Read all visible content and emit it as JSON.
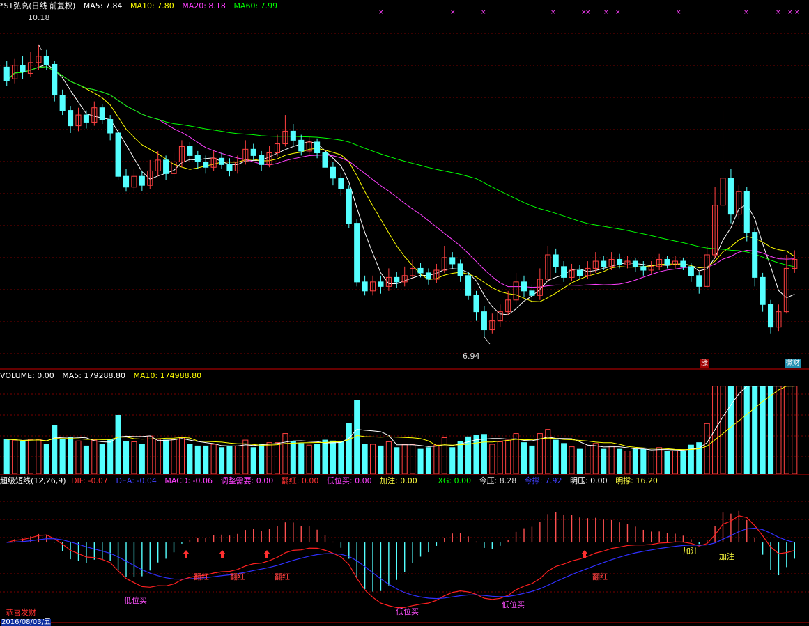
{
  "colors": {
    "bg": "#000000",
    "grid": "#7a0000",
    "divider": "#cc0000",
    "up": "#ff4040",
    "down": "#54ffff",
    "ma5": "#ffffff",
    "ma10": "#ffff00",
    "ma20": "#ff40ff",
    "ma60": "#00ff00",
    "dif": "#ff2020",
    "dea": "#3030ff",
    "macd_pos": "#ff5050",
    "macd_neg": "#54ffff",
    "signal": "#ff3030",
    "low_buy": "#ff50ff",
    "add": "#ffff40"
  },
  "price_panel": {
    "title": "*ST弘高(日线 前复权)",
    "ma5_label": "MA5: 7.84",
    "ma10_label": "MA10: 7.80",
    "ma20_label": "MA20: 8.18",
    "ma60_label": "MA60: 7.99",
    "high_label": "10.18",
    "low_label": "6.94",
    "badge_rise": "涨",
    "badge_fund": "微财"
  },
  "volume_panel": {
    "vol_label": "VOLUME: 0.00",
    "ma5_label": "MA5: 179288.80",
    "ma10_label": "MA10: 174988.80"
  },
  "indicator_panel": {
    "name": "超级短线(12,26,9)",
    "dif_label": "DIF: -0.07",
    "dea_label": "DEA: -0.04",
    "macd_label": "MACD: -0.06",
    "adjust_label": "调整需要: 0.00",
    "turn_red_label": "翻红: 0.00",
    "low_buy_label": "低位买: 0.00",
    "add_label": "加注: 0.00",
    "xg_label": "XG: 0.00",
    "today_press_label": "今压: 8.28",
    "today_support_label": "今撑: 7.92",
    "next_press_label": "明压: 0.00",
    "next_support_label": "明撑: 16.20",
    "signal_turn_red": "翻红",
    "signal_low_buy": "低位买",
    "signal_add": "加注",
    "footer": "恭喜发财",
    "date_partial": "2016/08/03/五"
  },
  "chart_data": {
    "type": "candlestick",
    "ylim": [
      6.6,
      10.55
    ],
    "high": 10.18,
    "low": 6.94,
    "ma_current": {
      "MA5": 7.84,
      "MA10": 7.8,
      "MA20": 8.18,
      "MA60": 7.99
    },
    "candles": [
      [
        9.93,
        9.78,
        10.0,
        9.72
      ],
      [
        9.8,
        9.95,
        10.02,
        9.75
      ],
      [
        9.95,
        9.88,
        10.05,
        9.8
      ],
      [
        9.86,
        9.98,
        10.1,
        9.82
      ],
      [
        9.98,
        10.05,
        10.18,
        9.9
      ],
      [
        10.05,
        9.96,
        10.12,
        9.9
      ],
      [
        9.96,
        9.62,
        10.0,
        9.55
      ],
      [
        9.62,
        9.45,
        9.68,
        9.4
      ],
      [
        9.45,
        9.28,
        9.5,
        9.2
      ],
      [
        9.28,
        9.4,
        9.48,
        9.22
      ],
      [
        9.4,
        9.32,
        9.45,
        9.25
      ],
      [
        9.32,
        9.48,
        9.55,
        9.28
      ],
      [
        9.48,
        9.35,
        9.52,
        9.3
      ],
      [
        9.35,
        9.2,
        9.4,
        9.12
      ],
      [
        9.2,
        8.72,
        9.25,
        8.68
      ],
      [
        8.72,
        8.6,
        8.8,
        8.55
      ],
      [
        8.6,
        8.72,
        8.8,
        8.55
      ],
      [
        8.72,
        8.62,
        8.78,
        8.56
      ],
      [
        8.62,
        8.78,
        8.9,
        8.58
      ],
      [
        8.78,
        8.9,
        9.0,
        8.72
      ],
      [
        8.9,
        8.75,
        8.95,
        8.68
      ],
      [
        8.75,
        8.88,
        8.98,
        8.7
      ],
      [
        8.88,
        9.05,
        9.12,
        8.82
      ],
      [
        9.05,
        8.95,
        9.1,
        8.88
      ],
      [
        8.95,
        8.88,
        9.0,
        8.8
      ],
      [
        8.88,
        8.82,
        8.95,
        8.75
      ],
      [
        8.82,
        8.92,
        9.0,
        8.78
      ],
      [
        8.92,
        8.85,
        8.98,
        8.8
      ],
      [
        8.85,
        8.78,
        8.92,
        8.72
      ],
      [
        8.78,
        8.88,
        8.95,
        8.75
      ],
      [
        8.88,
        9.02,
        9.12,
        8.85
      ],
      [
        9.02,
        8.95,
        9.08,
        8.9
      ],
      [
        8.95,
        8.85,
        9.0,
        8.78
      ],
      [
        8.85,
        8.98,
        9.06,
        8.82
      ],
      [
        8.98,
        9.08,
        9.18,
        8.94
      ],
      [
        9.08,
        9.22,
        9.4,
        9.05
      ],
      [
        9.22,
        9.12,
        9.3,
        9.05
      ],
      [
        9.12,
        9.0,
        9.18,
        8.95
      ],
      [
        9.0,
        9.1,
        9.16,
        8.95
      ],
      [
        9.1,
        8.98,
        9.14,
        8.92
      ],
      [
        8.98,
        8.82,
        9.02,
        8.75
      ],
      [
        8.82,
        8.7,
        8.88,
        8.62
      ],
      [
        8.7,
        8.58,
        8.75,
        8.5
      ],
      [
        8.58,
        8.2,
        8.62,
        8.15
      ],
      [
        8.2,
        7.55,
        8.25,
        7.5
      ],
      [
        7.55,
        7.45,
        7.62,
        7.4
      ],
      [
        7.45,
        7.55,
        7.62,
        7.4
      ],
      [
        7.55,
        7.5,
        7.62,
        7.42
      ],
      [
        7.5,
        7.6,
        7.7,
        7.45
      ],
      [
        7.6,
        7.55,
        7.66,
        7.48
      ],
      [
        7.55,
        7.62,
        7.72,
        7.5
      ],
      [
        7.62,
        7.7,
        7.8,
        7.58
      ],
      [
        7.7,
        7.65,
        7.76,
        7.6
      ],
      [
        7.65,
        7.58,
        7.7,
        7.52
      ],
      [
        7.58,
        7.68,
        7.75,
        7.54
      ],
      [
        7.68,
        7.82,
        7.95,
        7.65
      ],
      [
        7.82,
        7.75,
        7.88,
        7.7
      ],
      [
        7.75,
        7.62,
        7.8,
        7.55
      ],
      [
        7.62,
        7.4,
        7.66,
        7.35
      ],
      [
        7.4,
        7.22,
        7.45,
        7.12
      ],
      [
        7.22,
        7.02,
        7.28,
        6.94
      ],
      [
        7.02,
        7.12,
        7.2,
        6.98
      ],
      [
        7.12,
        7.22,
        7.3,
        7.05
      ],
      [
        7.22,
        7.35,
        7.45,
        7.18
      ],
      [
        7.35,
        7.55,
        7.65,
        7.3
      ],
      [
        7.55,
        7.45,
        7.62,
        7.38
      ],
      [
        7.45,
        7.4,
        7.52,
        7.32
      ],
      [
        7.4,
        7.58,
        7.7,
        7.35
      ],
      [
        7.58,
        7.85,
        7.95,
        7.55
      ],
      [
        7.85,
        7.72,
        7.92,
        7.65
      ],
      [
        7.72,
        7.6,
        7.78,
        7.55
      ],
      [
        7.6,
        7.68,
        7.75,
        7.56
      ],
      [
        7.68,
        7.62,
        7.74,
        7.58
      ],
      [
        7.62,
        7.7,
        7.78,
        7.58
      ],
      [
        7.7,
        7.78,
        7.88,
        7.65
      ],
      [
        7.78,
        7.72,
        7.84,
        7.68
      ],
      [
        7.72,
        7.8,
        7.88,
        7.68
      ],
      [
        7.8,
        7.74,
        7.86,
        7.7
      ],
      [
        7.74,
        7.78,
        7.84,
        7.7
      ],
      [
        7.78,
        7.72,
        7.82,
        7.66
      ],
      [
        7.72,
        7.68,
        7.78,
        7.62
      ],
      [
        7.68,
        7.72,
        7.78,
        7.64
      ],
      [
        7.72,
        7.8,
        7.86,
        7.68
      ],
      [
        7.8,
        7.74,
        7.84,
        7.7
      ],
      [
        7.74,
        7.78,
        7.84,
        7.7
      ],
      [
        7.78,
        7.72,
        7.82,
        7.68
      ],
      [
        7.72,
        7.62,
        7.76,
        7.55
      ],
      [
        7.62,
        7.5,
        7.66,
        7.42
      ],
      [
        7.5,
        7.85,
        7.95,
        7.48
      ],
      [
        7.85,
        8.4,
        8.6,
        7.82
      ],
      [
        8.4,
        8.7,
        9.45,
        8.35
      ],
      [
        8.7,
        8.3,
        8.8,
        8.2
      ],
      [
        8.3,
        8.55,
        8.62,
        8.25
      ],
      [
        8.55,
        8.1,
        8.6,
        8.0
      ],
      [
        8.1,
        7.6,
        8.15,
        7.5
      ],
      [
        7.6,
        7.3,
        7.65,
        7.22
      ],
      [
        7.3,
        7.05,
        7.35,
        6.98
      ],
      [
        7.05,
        7.22,
        7.3,
        7.0
      ],
      [
        7.22,
        7.7,
        7.85,
        7.2
      ],
      [
        7.7,
        7.8,
        7.9,
        7.65
      ]
    ],
    "volume_ylim": [
      0,
      1000000
    ],
    "macd_ylim": [
      -0.5,
      0.35
    ]
  }
}
